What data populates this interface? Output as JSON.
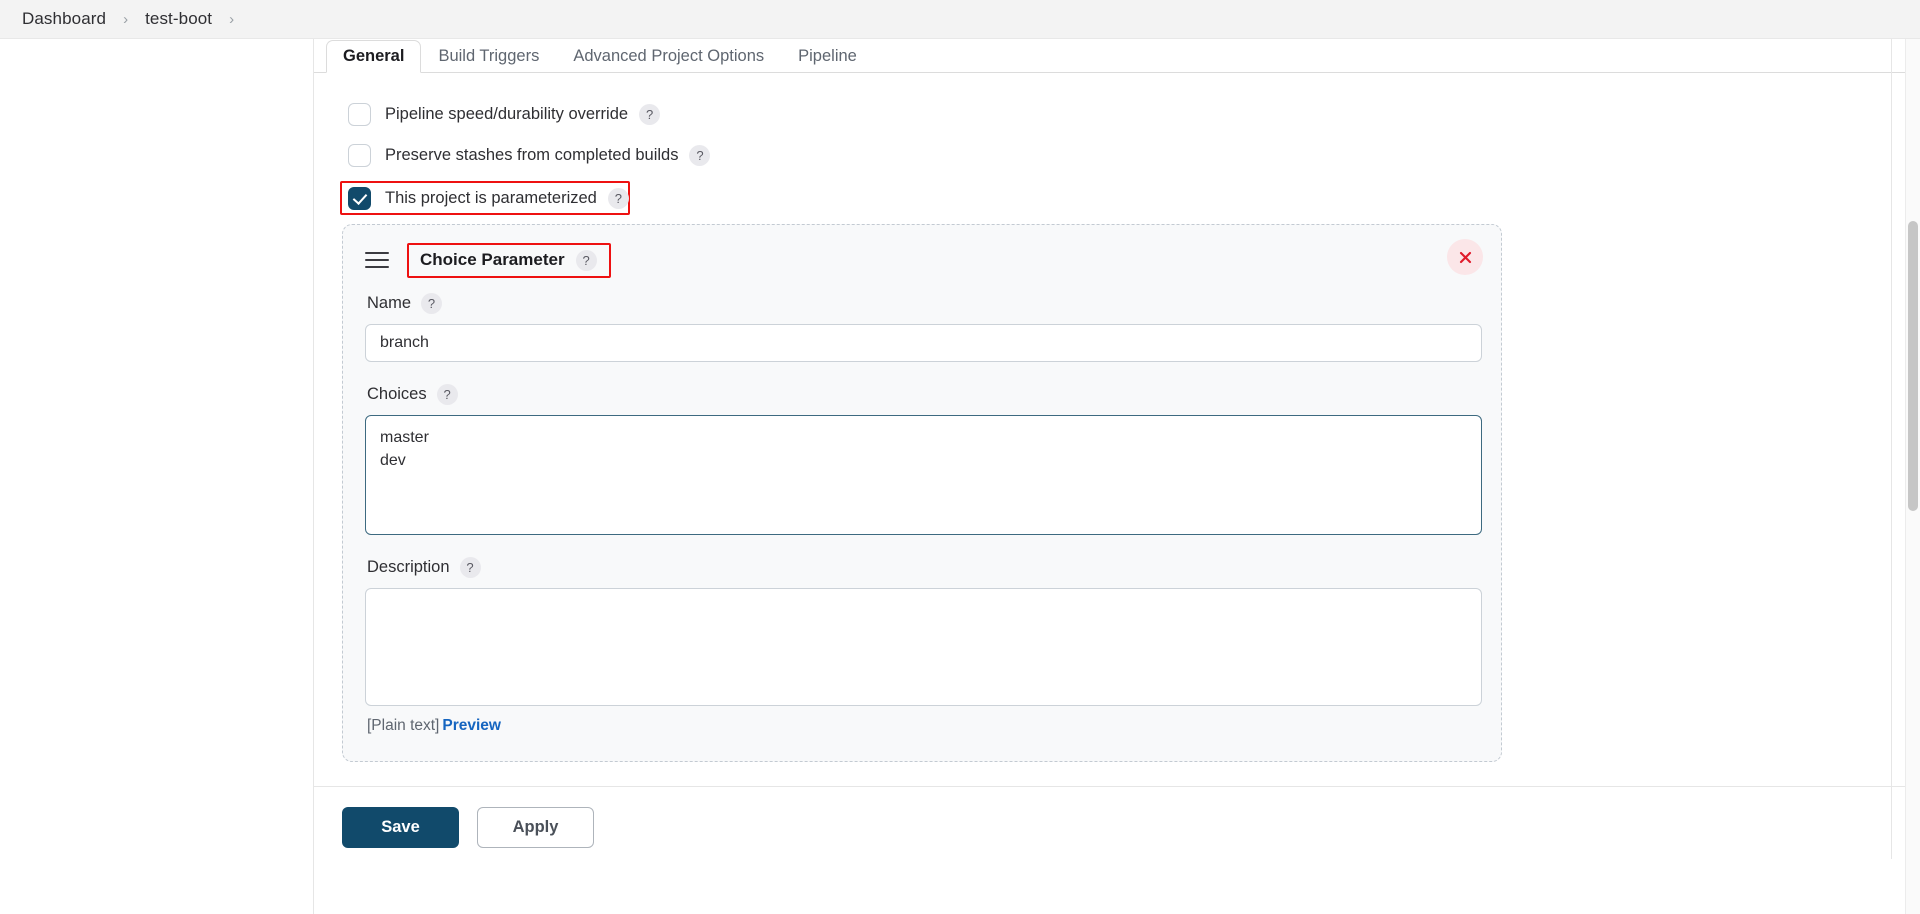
{
  "breadcrumb": {
    "items": [
      {
        "label": "Dashboard"
      },
      {
        "label": "test-boot"
      }
    ],
    "separator": "›"
  },
  "tabs": [
    {
      "label": "General",
      "active": true
    },
    {
      "label": "Build Triggers",
      "active": false
    },
    {
      "label": "Advanced Project Options",
      "active": false
    },
    {
      "label": "Pipeline",
      "active": false
    }
  ],
  "checkboxes": [
    {
      "label": "Pipeline speed/durability override",
      "checked": false,
      "help": "?",
      "highlighted": false
    },
    {
      "label": "Preserve stashes from completed builds",
      "checked": false,
      "help": "?",
      "highlighted": false
    },
    {
      "label": "This project is parameterized",
      "checked": true,
      "help": "?",
      "highlighted": true
    }
  ],
  "parameter_card": {
    "drag_handle_icon": "hamburger-drag-icon",
    "title": "Choice Parameter",
    "title_help": "?",
    "close_icon": "close-x-icon",
    "fields": {
      "name": {
        "label": "Name",
        "help": "?",
        "value": "branch",
        "placeholder": ""
      },
      "choices": {
        "label": "Choices",
        "help": "?",
        "value": "master\ndev",
        "placeholder": "",
        "focused": true
      },
      "description": {
        "label": "Description",
        "help": "?",
        "value": "",
        "placeholder": ""
      }
    },
    "markup_note": "[Plain text]",
    "preview_link": "Preview"
  },
  "footer": {
    "save_label": "Save",
    "apply_label": "Apply"
  },
  "colors": {
    "accent_dark": "#114a6b",
    "annotation_red": "#ee1111",
    "link_blue": "#1565c0",
    "close_red": "#e01b2b",
    "focus_border": "#3d6a80"
  }
}
